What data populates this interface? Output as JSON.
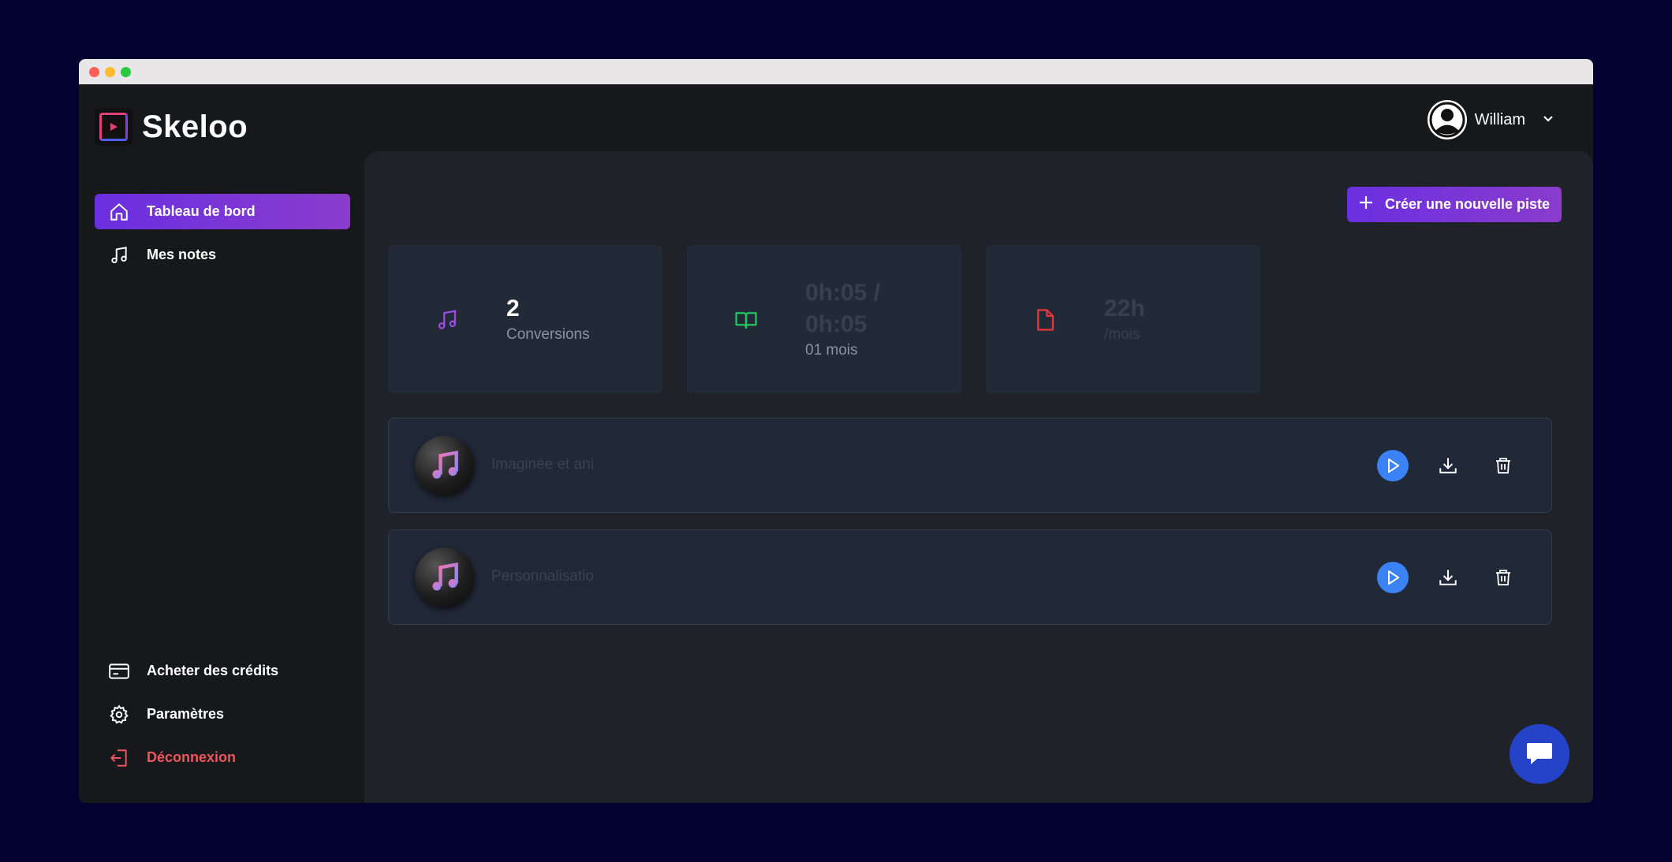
{
  "brand": {
    "name": "Skeloo"
  },
  "user": {
    "name": "William"
  },
  "sidebar": {
    "top_items": [
      {
        "label": "Tableau de bord",
        "icon": "home-icon",
        "active": true
      },
      {
        "label": "Mes notes",
        "icon": "music-note-icon",
        "active": false
      }
    ],
    "bottom_items": [
      {
        "label": "Acheter des crédits",
        "icon": "credit-card-icon"
      },
      {
        "label": "Paramètres",
        "icon": "gear-icon"
      },
      {
        "label": "Déconnexion",
        "icon": "logout-icon"
      }
    ]
  },
  "main": {
    "create_button_label": "Créer une nouvelle piste",
    "stats": [
      {
        "value": "2",
        "label": "Conversions",
        "icon": "music-note-icon",
        "icon_color": "#9b4de0"
      },
      {
        "value_line1": "0h:05 /",
        "value_line2": "0h:05",
        "label": "01 mois",
        "icon": "book-icon",
        "icon_color": "#22c55e"
      },
      {
        "value": "22h",
        "label": "/mois",
        "icon": "file-icon",
        "icon_color": "#e5383b"
      }
    ],
    "tracks": [
      {
        "title": "Imaginée et ani"
      },
      {
        "title": "Personnalisatio"
      }
    ]
  },
  "colors": {
    "accent_gradient_start": "#6a2fe0",
    "accent_gradient_end": "#8a3ccc",
    "play_blue": "#3b82f6",
    "logout_red": "#f0555d",
    "chat_blue": "#2443c8"
  }
}
